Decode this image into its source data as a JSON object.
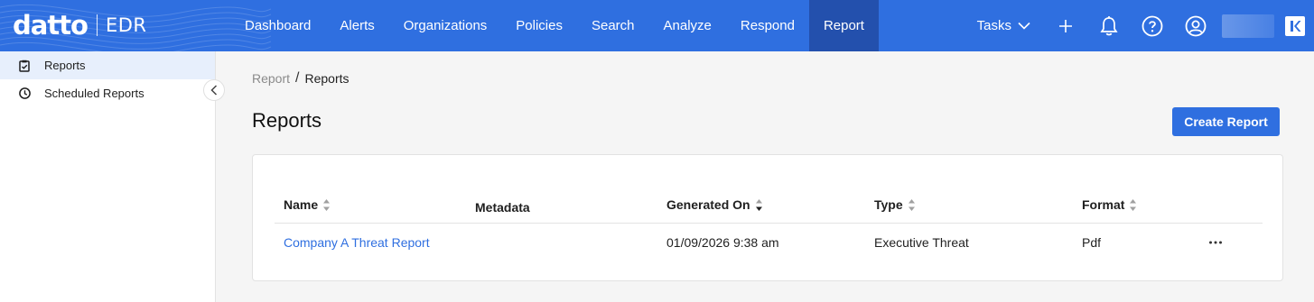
{
  "app": {
    "brand": "datto",
    "product": "EDR"
  },
  "nav": {
    "items": [
      {
        "label": "Dashboard"
      },
      {
        "label": "Alerts"
      },
      {
        "label": "Organizations"
      },
      {
        "label": "Policies"
      },
      {
        "label": "Search"
      },
      {
        "label": "Analyze"
      },
      {
        "label": "Respond"
      },
      {
        "label": "Report",
        "active": true
      }
    ],
    "tasks_label": "Tasks",
    "icons": [
      "plus-icon",
      "bell-icon",
      "help-icon",
      "user-icon",
      "kaseya-icon"
    ]
  },
  "sidebar": {
    "items": [
      {
        "label": "Reports",
        "icon": "clipboard-icon",
        "active": true
      },
      {
        "label": "Scheduled Reports",
        "icon": "clock-icon"
      }
    ]
  },
  "breadcrumb": {
    "parent": "Report",
    "separator": "/",
    "current": "Reports"
  },
  "page": {
    "title": "Reports",
    "create_button": "Create Report"
  },
  "table": {
    "columns": {
      "name": "Name",
      "metadata": "Metadata",
      "generated_on": "Generated On",
      "type": "Type",
      "format": "Format"
    },
    "rows": [
      {
        "name": "Company A Threat Report",
        "metadata": "",
        "generated_on": "01/09/2026 9:38 am",
        "type": "Executive Threat",
        "format": "Pdf"
      }
    ]
  },
  "colors": {
    "accent": "#2f6fe0",
    "nav_active": "#2350ad",
    "sidebar_active": "#e7effc"
  }
}
